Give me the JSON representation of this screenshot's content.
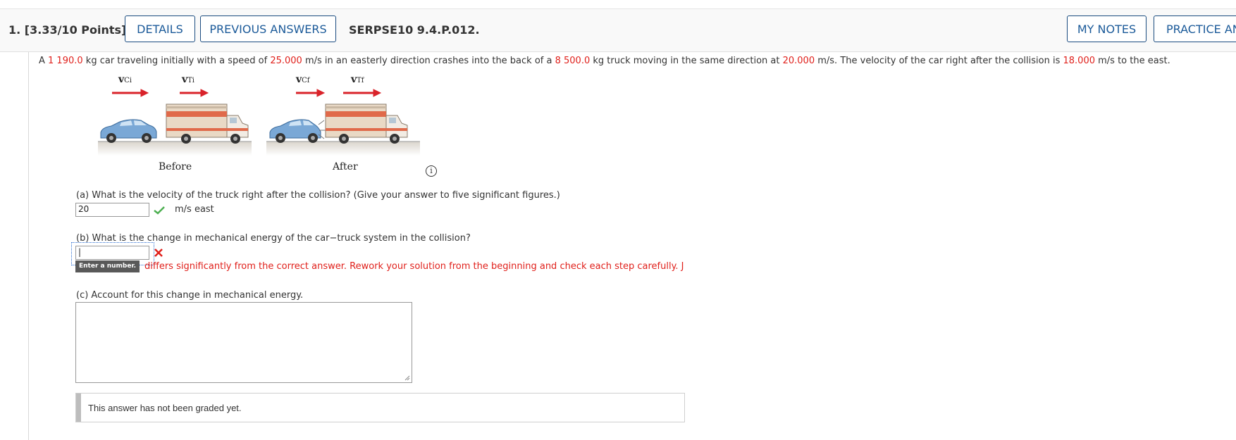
{
  "header": {
    "question_number": "1.",
    "points": "[3.33/10 Points]",
    "details_label": "DETAILS",
    "previous_answers_label": "PREVIOUS ANSWERS",
    "problem_code": "SERPSE10 9.4.P.012.",
    "my_notes_label": "MY NOTES",
    "practice_label": "PRACTICE AN"
  },
  "problem": {
    "t1": "A ",
    "car_mass": "1 190.0",
    "t2": " kg car traveling initially with a speed of ",
    "car_speed": "25.000",
    "t3": " m/s in an easterly direction crashes into the back of a ",
    "truck_mass": "8 500.0",
    "t4": " kg truck moving in the same direction at ",
    "truck_speed": "20.000",
    "t5": " m/s. The velocity of the car right after the collision is ",
    "car_final": "18.000",
    "t6": " m/s to the east."
  },
  "figure": {
    "before_label": "Before",
    "after_label": "After",
    "v_ci": "v",
    "v_ci_sub": "Ci",
    "v_ti": "v",
    "v_ti_sub": "Ti",
    "v_cf": "v",
    "v_cf_sub": "Cf",
    "v_tf": "v",
    "v_tf_sub": "Tf",
    "info_icon": "i"
  },
  "part_a": {
    "question": "(a) What is the velocity of the truck right after the collision? (Give your answer to five significant figures.)",
    "answer": "20",
    "units": "m/s east",
    "status": "correct"
  },
  "part_b": {
    "question": "(b) What is the change in mechanical energy of the car−truck system in the collision?",
    "answer": "|",
    "tooltip": "Enter a number.",
    "feedback": "differs significantly from the correct answer. Rework your solution from the beginning and check each step carefully. J",
    "status": "incorrect"
  },
  "part_c": {
    "question": "(c) Account for this change in mechanical energy.",
    "answer": ""
  },
  "grading": {
    "message": "This answer has not been graded yet."
  },
  "colors": {
    "accent": "#1b5a99",
    "error": "#e0201b",
    "correct": "#4caf50"
  }
}
